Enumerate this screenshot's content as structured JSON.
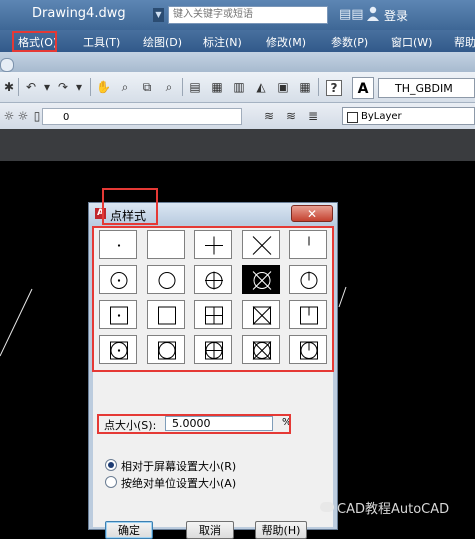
{
  "window": {
    "title": "Drawing4.dwg",
    "search_placeholder": "键入关键字或短语",
    "login_label": "登录"
  },
  "menu": {
    "items": [
      "格式(O)",
      "工具(T)",
      "绘图(D)",
      "标注(N)",
      "修改(M)",
      "参数(P)",
      "窗口(W)",
      "帮助"
    ]
  },
  "toolbar": {
    "text_style": "TH_GBDIM",
    "layer_name": "0",
    "color": "ByLayer"
  },
  "dialog": {
    "title": "点样式",
    "selected_index": 8,
    "point_styles": [
      {
        "style": 0
      },
      {
        "style": 1
      },
      {
        "style": 2
      },
      {
        "style": 3
      },
      {
        "style": 4
      },
      {
        "style": 32
      },
      {
        "style": 33
      },
      {
        "style": 34
      },
      {
        "style": 35
      },
      {
        "style": 36
      },
      {
        "style": 64
      },
      {
        "style": 65
      },
      {
        "style": 66
      },
      {
        "style": 67
      },
      {
        "style": 68
      },
      {
        "style": 96
      },
      {
        "style": 97
      },
      {
        "style": 98
      },
      {
        "style": 99
      },
      {
        "style": 100
      }
    ],
    "size_label": "点大小(S):",
    "size_value": "5.0000",
    "size_unit": "%",
    "radio_relative": "相对于屏幕设置大小(R)",
    "radio_absolute": "按绝对单位设置大小(A)",
    "ok_label": "确定",
    "cancel_label": "取消",
    "help_label": "帮助(H)"
  },
  "watermark": "CAD教程AutoCAD",
  "colors": {
    "highlight": "#e53935",
    "titlebar": "#4a74a4",
    "canvas": "#000000"
  }
}
